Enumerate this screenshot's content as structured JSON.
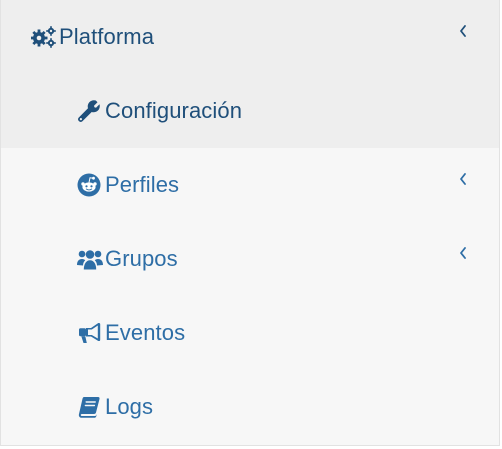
{
  "menu": {
    "section": {
      "label": "Platforma",
      "icon": "gears-icon",
      "expanded_indicator": "chevron-left-icon"
    },
    "items": [
      {
        "label": "Configuración",
        "icon": "wrench-icon",
        "active": true,
        "has_children": false
      },
      {
        "label": "Perfiles",
        "icon": "reddit-icon",
        "active": false,
        "has_children": true
      },
      {
        "label": "Grupos",
        "icon": "users-icon",
        "active": false,
        "has_children": true
      },
      {
        "label": "Eventos",
        "icon": "bullhorn-icon",
        "active": false,
        "has_children": false
      },
      {
        "label": "Logs",
        "icon": "book-icon",
        "active": false,
        "has_children": false
      }
    ]
  },
  "colors": {
    "accent": "#2e6ea6",
    "active_text": "#1f4f7a",
    "active_bg": "#eeeeee",
    "menu_bg": "#f7f7f7"
  }
}
